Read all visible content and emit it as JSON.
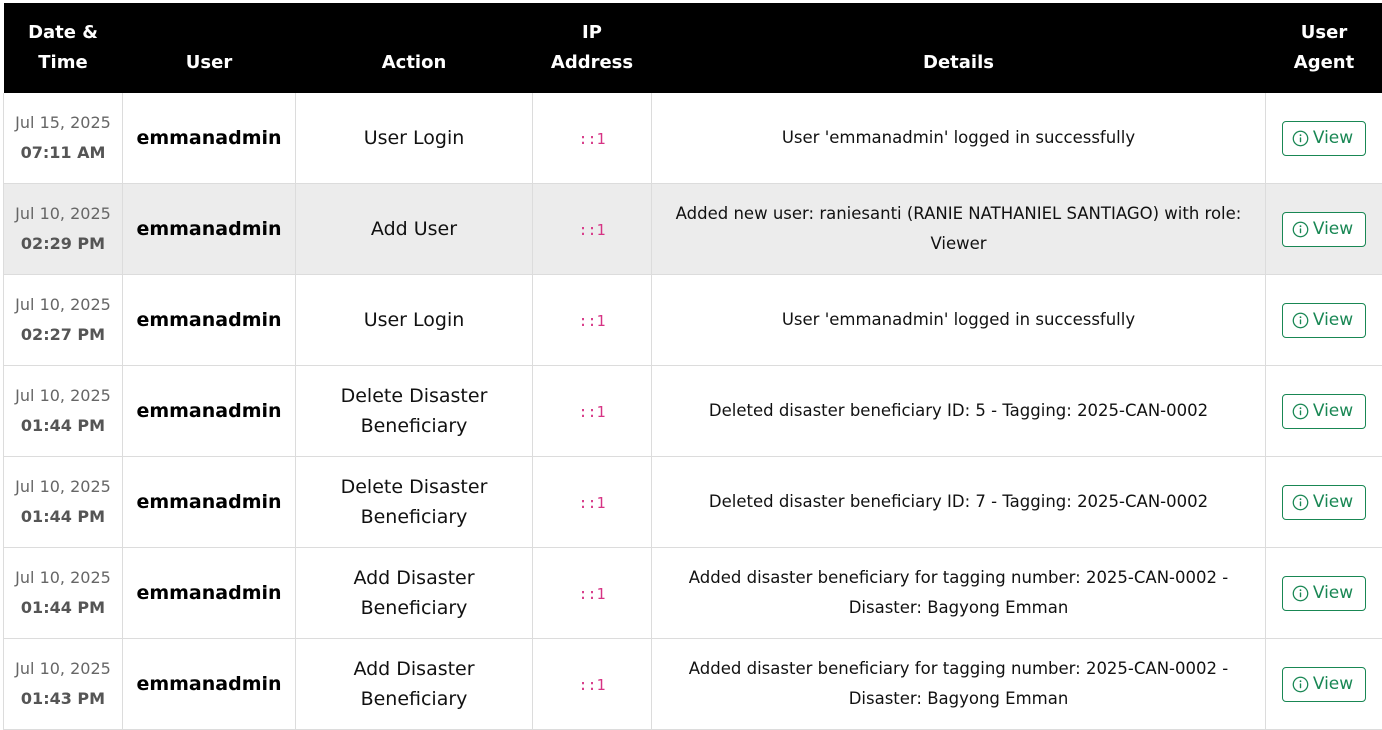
{
  "table": {
    "headers": {
      "datetime": "Date & Time",
      "user": "User",
      "action": "Action",
      "ip": "IP Address",
      "details": "Details",
      "user_agent": "User Agent"
    },
    "view_label": "View",
    "rows": [
      {
        "date": "Jul 15, 2025",
        "time": "07:11 AM",
        "user": "emmanadmin",
        "action": "User Login",
        "ip": "::1",
        "details": "User 'emmanadmin' logged in successfully"
      },
      {
        "date": "Jul 10, 2025",
        "time": "02:29 PM",
        "user": "emmanadmin",
        "action": "Add User",
        "ip": "::1",
        "details": "Added new user: raniesanti (RANIE NATHANIEL SANTIAGO) with role: Viewer"
      },
      {
        "date": "Jul 10, 2025",
        "time": "02:27 PM",
        "user": "emmanadmin",
        "action": "User Login",
        "ip": "::1",
        "details": "User 'emmanadmin' logged in successfully"
      },
      {
        "date": "Jul 10, 2025",
        "time": "01:44 PM",
        "user": "emmanadmin",
        "action": "Delete Disaster Beneficiary",
        "ip": "::1",
        "details": "Deleted disaster beneficiary ID: 5 - Tagging: 2025-CAN-0002"
      },
      {
        "date": "Jul 10, 2025",
        "time": "01:44 PM",
        "user": "emmanadmin",
        "action": "Delete Disaster Beneficiary",
        "ip": "::1",
        "details": "Deleted disaster beneficiary ID: 7 - Tagging: 2025-CAN-0002"
      },
      {
        "date": "Jul 10, 2025",
        "time": "01:44 PM",
        "user": "emmanadmin",
        "action": "Add Disaster Beneficiary",
        "ip": "::1",
        "details": "Added disaster beneficiary for tagging number: 2025-CAN-0002 - Disaster: Bagyong Emman"
      },
      {
        "date": "Jul 10, 2025",
        "time": "01:43 PM",
        "user": "emmanadmin",
        "action": "Add Disaster Beneficiary",
        "ip": "::1",
        "details": "Added disaster beneficiary for tagging number: 2025-CAN-0002 - Disaster: Bagyong Emman"
      }
    ]
  },
  "colors": {
    "header_bg": "#000000",
    "header_text": "#ffffff",
    "highlight_row": "#ececec",
    "ip_text": "#d63384",
    "view_button": "#198754"
  },
  "icons": {
    "view_button_icon": "info-circle-icon"
  }
}
